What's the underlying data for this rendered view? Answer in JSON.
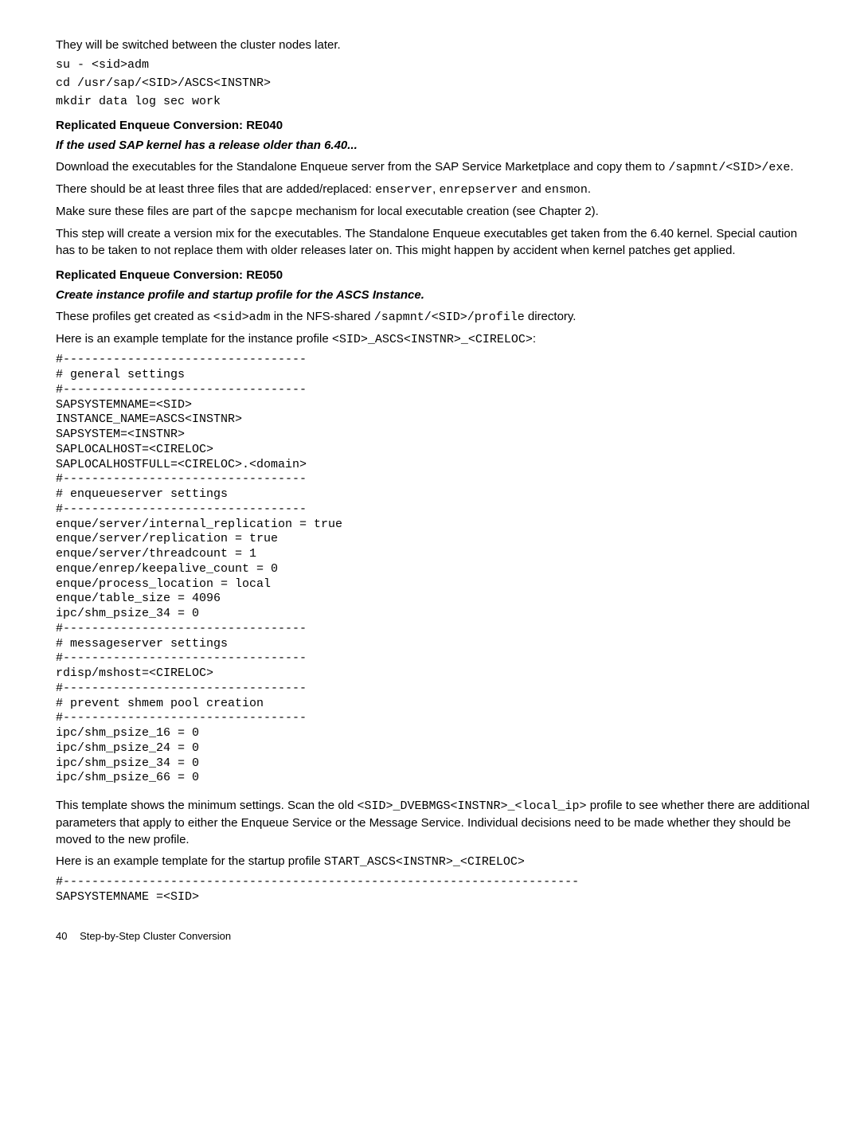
{
  "p1": "They will be switched between the cluster nodes later.",
  "cmd1": "su - <sid>adm",
  "cmd2": "cd /usr/sap/<SID>/ASCS<INSTNR>",
  "cmd3": "mkdir data log sec work",
  "h1": "Replicated Enqueue Conversion: RE040",
  "h1sub": "If the used SAP kernel has a release older than 6.40...",
  "p2a": "Download the executables for the Standalone Enqueue server from the SAP Service Marketplace and copy them to ",
  "p2b": "/sapmnt/<SID>/exe",
  "p2c": ".",
  "p3a": "There should be at least three files that are added/replaced: ",
  "p3b": "enserver",
  "p3c": ", ",
  "p3d": "enrepserver",
  "p3e": " and ",
  "p3f": "ensmon",
  "p3g": ".",
  "p4a": "Make sure these files are part of the ",
  "p4b": "sapcpe",
  "p4c": " mechanism for local executable creation (see Chapter 2).",
  "p5": "This step will create a version mix for the executables. The Standalone Enqueue executables get taken from the 6.40 kernel. Special caution has to be taken to not replace them with older releases later on. This might happen by accident when kernel patches get applied.",
  "h2": "Replicated Enqueue Conversion: RE050",
  "h2sub": "Create instance profile and startup profile for the ASCS Instance.",
  "p6a": "These profiles get created as ",
  "p6b": "<sid>adm",
  "p6c": " in the NFS-shared ",
  "p6d": "/sapmnt/<SID>/profile",
  "p6e": " directory.",
  "p7a": "Here is an example template for the instance profile ",
  "p7b": "<SID>_ASCS<INSTNR>_<CIRELOC>",
  "p7c": ":",
  "code1": "#----------------------------------\n# general settings\n#----------------------------------\nSAPSYSTEMNAME=<SID>\nINSTANCE_NAME=ASCS<INSTNR>\nSAPSYSTEM=<INSTNR>\nSAPLOCALHOST=<CIRELOC>\nSAPLOCALHOSTFULL=<CIRELOC>.<domain>\n#----------------------------------\n# enqueueserver settings\n#----------------------------------\nenque/server/internal_replication = true\nenque/server/replication = true\nenque/server/threadcount = 1\nenque/enrep/keepalive_count = 0\nenque/process_location = local\nenque/table_size = 4096\nipc/shm_psize_34 = 0\n#----------------------------------\n# messageserver settings\n#----------------------------------\nrdisp/mshost=<CIRELOC>\n#----------------------------------\n# prevent shmem pool creation\n#----------------------------------\nipc/shm_psize_16 = 0\nipc/shm_psize_24 = 0\nipc/shm_psize_34 = 0\nipc/shm_psize_66 = 0",
  "p8a": "This template shows the minimum settings. Scan the old ",
  "p8b": "<SID>_DVEBMGS<INSTNR>_<local_ip>",
  "p8c": " profile to see whether there are additional parameters that apply to either the Enqueue Service or the Message Service. Individual decisions need to be made whether they should be moved to the new profile.",
  "p9a": "Here is an example template for the startup profile ",
  "p9b": "START_ASCS<INSTNR>_<CIRELOC>",
  "code2": "#------------------------------------------------------------------------\nSAPSYSTEMNAME =<SID>",
  "footer_page": "40",
  "footer_title": "Step-by-Step Cluster Conversion"
}
